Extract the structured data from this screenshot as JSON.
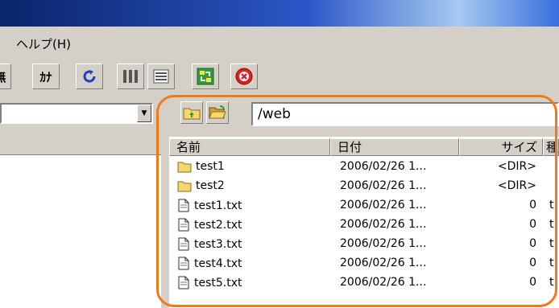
{
  "menubar": {
    "help_label": "ヘルプ(H)"
  },
  "toolbar": {
    "btn1_glyph": "無",
    "btn2_glyph": "ｶﾅ"
  },
  "path_bar": {
    "value": "/web"
  },
  "list": {
    "columns": {
      "name": "名前",
      "date": "日付",
      "size": "サイズ",
      "type": "種"
    },
    "rows": [
      {
        "name": "test1",
        "kind": "folder",
        "date": "2006/02/26 1...",
        "size": "<DIR>",
        "type": ""
      },
      {
        "name": "test2",
        "kind": "folder",
        "date": "2006/02/26 1...",
        "size": "<DIR>",
        "type": ""
      },
      {
        "name": "test1.txt",
        "kind": "file",
        "date": "2006/02/26 1...",
        "size": "0",
        "type": "t"
      },
      {
        "name": "test2.txt",
        "kind": "file",
        "date": "2006/02/26 1...",
        "size": "0",
        "type": "t"
      },
      {
        "name": "test3.txt",
        "kind": "file",
        "date": "2006/02/26 1...",
        "size": "0",
        "type": "t"
      },
      {
        "name": "test4.txt",
        "kind": "file",
        "date": "2006/02/26 1...",
        "size": "0",
        "type": "t"
      },
      {
        "name": "test5.txt",
        "kind": "file",
        "date": "2006/02/26 1...",
        "size": "0",
        "type": "t"
      }
    ]
  },
  "colors": {
    "highlight": "#ee7a1c",
    "titlebar": "#0a246a",
    "folder": "#f5d76e"
  }
}
